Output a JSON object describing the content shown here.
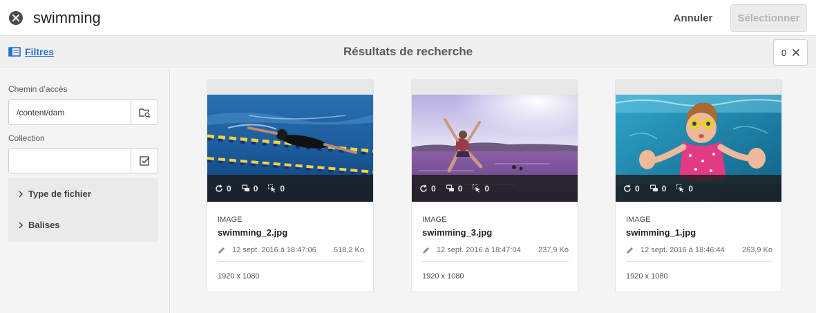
{
  "search": {
    "query": "swimming"
  },
  "header": {
    "cancel_label": "Annuler",
    "select_label": "Sélectionner"
  },
  "subheader": {
    "filters_label": "Filtres",
    "title": "Résultats de recherche",
    "selected_count": "0"
  },
  "filters": {
    "path_label": "Chemin d’accès",
    "path_value": "/content/dam",
    "collection_label": "Collection",
    "collection_value": "",
    "sections": [
      {
        "label": "Type de fichier"
      },
      {
        "label": "Balises"
      }
    ]
  },
  "results": [
    {
      "type": "IMAGE",
      "name": "swimming_2.jpg",
      "modified": "12 sept. 2016 à 18:47:06",
      "size": "518,2 Ko",
      "dimensions": "1920 x 1080",
      "stats": {
        "versions": "0",
        "comments": "0",
        "tasks": "0"
      }
    },
    {
      "type": "IMAGE",
      "name": "swimming_3.jpg",
      "modified": "12 sept. 2016 à 18:47:04",
      "size": "237,9 Ko",
      "dimensions": "1920 x 1080",
      "stats": {
        "versions": "0",
        "comments": "0",
        "tasks": "0"
      }
    },
    {
      "type": "IMAGE",
      "name": "swimming_1.jpg",
      "modified": "12 sept. 2016 à 18:46:44",
      "size": "263,9 Ko",
      "dimensions": "1920 x 1080",
      "stats": {
        "versions": "0",
        "comments": "0",
        "tasks": "0"
      }
    }
  ],
  "colors": {
    "link": "#2c6ecb",
    "disabled_text": "#b4b4b4",
    "rail_bg": "#f4f4f4"
  }
}
